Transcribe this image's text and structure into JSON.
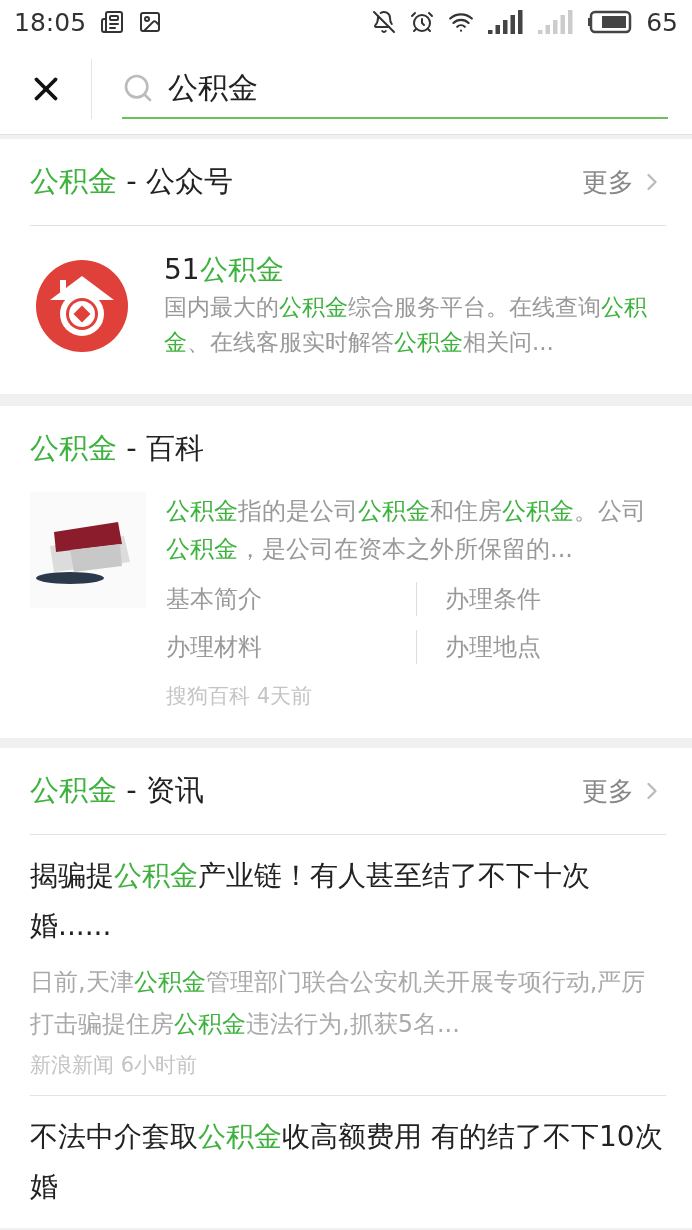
{
  "status_bar": {
    "time": "18:05",
    "battery": "65"
  },
  "search": {
    "value": "公积金"
  },
  "accounts": {
    "title": "**公积金** - 公众号",
    "more": "更多",
    "items": [
      {
        "name": "51**公积金**",
        "description": "国内最大的**公积金**综合服务平台。在线查询**公积金**、在线客服实时解答**公积金**相关问..."
      }
    ]
  },
  "encyclopedia": {
    "title": "**公积金** - 百科",
    "summary": "**公积金**指的是公司**公积金**和住房**公积金**。公司**公积金**，是公司在资本之外所保留的...",
    "links": [
      "基本简介",
      "办理条件",
      "办理材料",
      "办理地点"
    ],
    "source": "搜狗百科",
    "time": "4天前"
  },
  "news": {
    "title": "**公积金** - 资讯",
    "more": "更多",
    "items": [
      {
        "headline": "揭骗提**公积金**产业链！有人甚至结了不下十次婚......",
        "summary": "日前,天津**公积金**管理部门联合公安机关开展专项行动,严厉打击骗提住房**公积金**违法行为,抓获5名...",
        "source": "新浪新闻",
        "time": "6小时前"
      },
      {
        "headline": "不法中介套取**公积金**收高额费用 有的结了不下10次婚"
      }
    ]
  }
}
